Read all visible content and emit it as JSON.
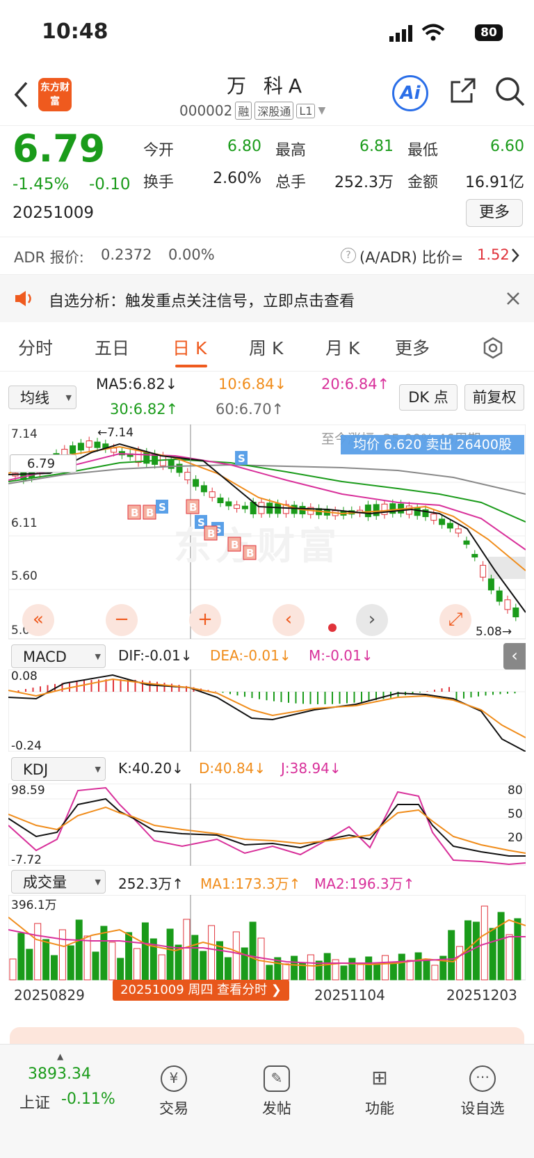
{
  "status_bar": {
    "time": "10:48",
    "battery": "80"
  },
  "header": {
    "logo_text": "东方财富",
    "stock_name": "万 科A",
    "code": "000002",
    "tags": [
      "融",
      "深股通",
      "L1"
    ],
    "ai_label": "Ai"
  },
  "quote": {
    "price": "6.79",
    "change_pct": "-1.45%",
    "change": "-0.10",
    "date": "20251009",
    "open_label": "今开",
    "open": "6.80",
    "high_label": "最高",
    "high": "6.81",
    "low_label": "最低",
    "low": "6.60",
    "turnover_label": "换手",
    "turnover": "2.60%",
    "volume_label": "总手",
    "volume": "252.3万",
    "amount_label": "金额",
    "amount": "16.91亿",
    "more_label": "更多"
  },
  "adr": {
    "label": "ADR 报价:",
    "value": "0.2372",
    "pct": "0.00%",
    "ratio_label": "(A/ADR) 比价=",
    "ratio": "1.52"
  },
  "notice": {
    "text": "自选分析：触发重点关注信号，立即点击查看"
  },
  "tabs": [
    "分时",
    "五日",
    "日 K",
    "周 K",
    "月 K",
    "更多"
  ],
  "active_tab": "日 K",
  "indicator_bar": {
    "ma_select": "均线",
    "ma5": "MA5:6.82↓",
    "ma10": "10:6.84↓",
    "ma20": "20:6.84↑",
    "ma30": "30:6.82↑",
    "ma60": "60:6.70↑",
    "dk_label": "DK 点",
    "fq_label": "前复权"
  },
  "kline": {
    "y_top": "7.14",
    "y_mid1": "6.11",
    "y_mid2": "5.60",
    "y_bottom": "5.08",
    "max_label": "←7.14",
    "min_label": "5.08→",
    "price_tag": "6.79",
    "tooltip_bg": "至今涨幅 -25.00%  46周期",
    "tooltip": "均价 6.620 卖出 26400股",
    "watermark": "东方财富"
  },
  "macd": {
    "select": "MACD",
    "dif": "DIF:-0.01↓",
    "dea": "DEA:-0.01↓",
    "m": "M:-0.01↓",
    "y_top": "0.08",
    "y_bottom": "-0.24"
  },
  "kdj": {
    "select": "KDJ",
    "k": "K:40.20↓",
    "d": "D:40.84↓",
    "j": "J:38.94↓",
    "y_top": "98.59",
    "y_bottom": "-7.72",
    "r80": "80",
    "r50": "50",
    "r20": "20"
  },
  "vol": {
    "select": "成交量",
    "value": "252.3万↑",
    "ma1": "MA1:173.3万↑",
    "ma2": "MA2:196.3万↑",
    "y_top": "396.1万"
  },
  "x_axis": [
    "20250829",
    "20251104",
    "20251203"
  ],
  "date_pill": "20251009 周四 查看分时 ❯",
  "bottom_nav": {
    "index_value": "3893.34",
    "index_name": "上证",
    "index_pct": "-0.11%",
    "items": [
      "交易",
      "发帖",
      "功能",
      "设自选"
    ]
  },
  "colors": {
    "up": "#e0323a",
    "down": "#1a9b1a",
    "accent": "#ef5a1e",
    "ma10": "#f08c1a",
    "ma20": "#d8309a"
  }
}
